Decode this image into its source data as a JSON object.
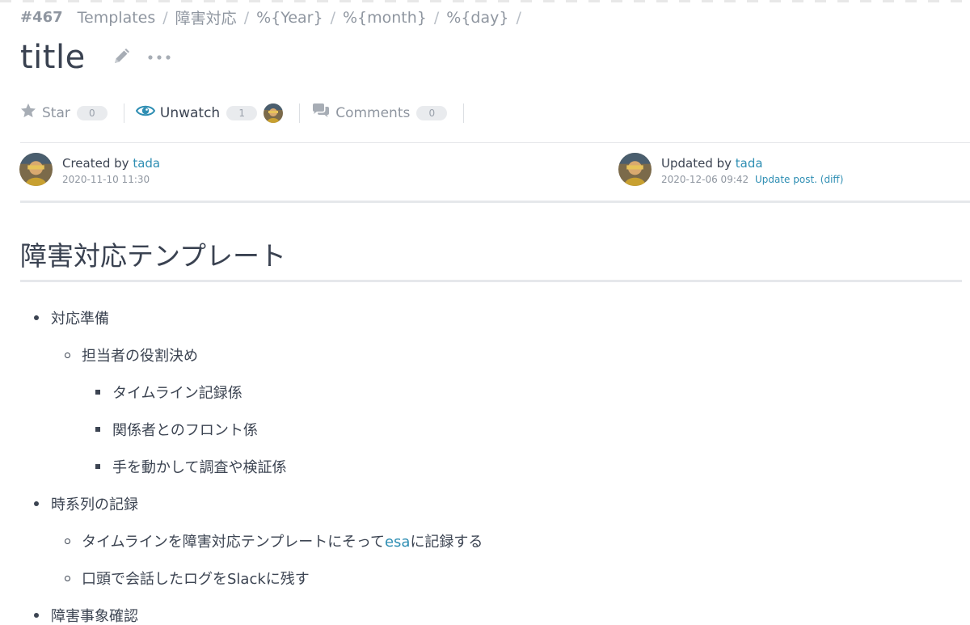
{
  "breadcrumb": {
    "number": "#467",
    "items": [
      "Templates",
      "障害対応",
      "%{Year}",
      "%{month}",
      "%{day}"
    ]
  },
  "post": {
    "title": "title"
  },
  "actions": {
    "star_label": "Star",
    "star_count": "0",
    "watch_label": "Unwatch",
    "watch_count": "1",
    "comments_label": "Comments",
    "comments_count": "0"
  },
  "created": {
    "prefix": "Created by",
    "user": "tada",
    "datetime": "2020-11-10 11:30"
  },
  "updated": {
    "prefix": "Updated by",
    "user": "tada",
    "datetime": "2020-12-06 09:42",
    "link": "Update post. (diff)"
  },
  "content": {
    "heading": "障害対応テンプレート",
    "items": [
      {
        "level": 1,
        "text": "対応準備"
      },
      {
        "level": 2,
        "text": "担当者の役割決め"
      },
      {
        "level": 3,
        "text": "タイムライン記録係"
      },
      {
        "level": 3,
        "text": "関係者とのフロント係"
      },
      {
        "level": 3,
        "text": "手を動かして調査や検証係"
      },
      {
        "level": 1,
        "text": "時系列の記録"
      },
      {
        "level": 2,
        "text_before": "タイムラインを障害対応テンプレートにそって",
        "link": "esa",
        "text_after": "に記録する"
      },
      {
        "level": 2,
        "text": "口頭で会話したログをSlackに残す"
      },
      {
        "level": 1,
        "text": "障害事象確認"
      }
    ]
  },
  "colors": {
    "link": "#2e8eb3",
    "text": "#3c4452",
    "muted": "#8f96a0",
    "watch_icon": "#2e8eb3"
  },
  "icons": {
    "star": "star-icon",
    "watch": "eye-icon",
    "comments": "comments-icon",
    "edit": "pencil-icon",
    "more": "more-icon"
  }
}
